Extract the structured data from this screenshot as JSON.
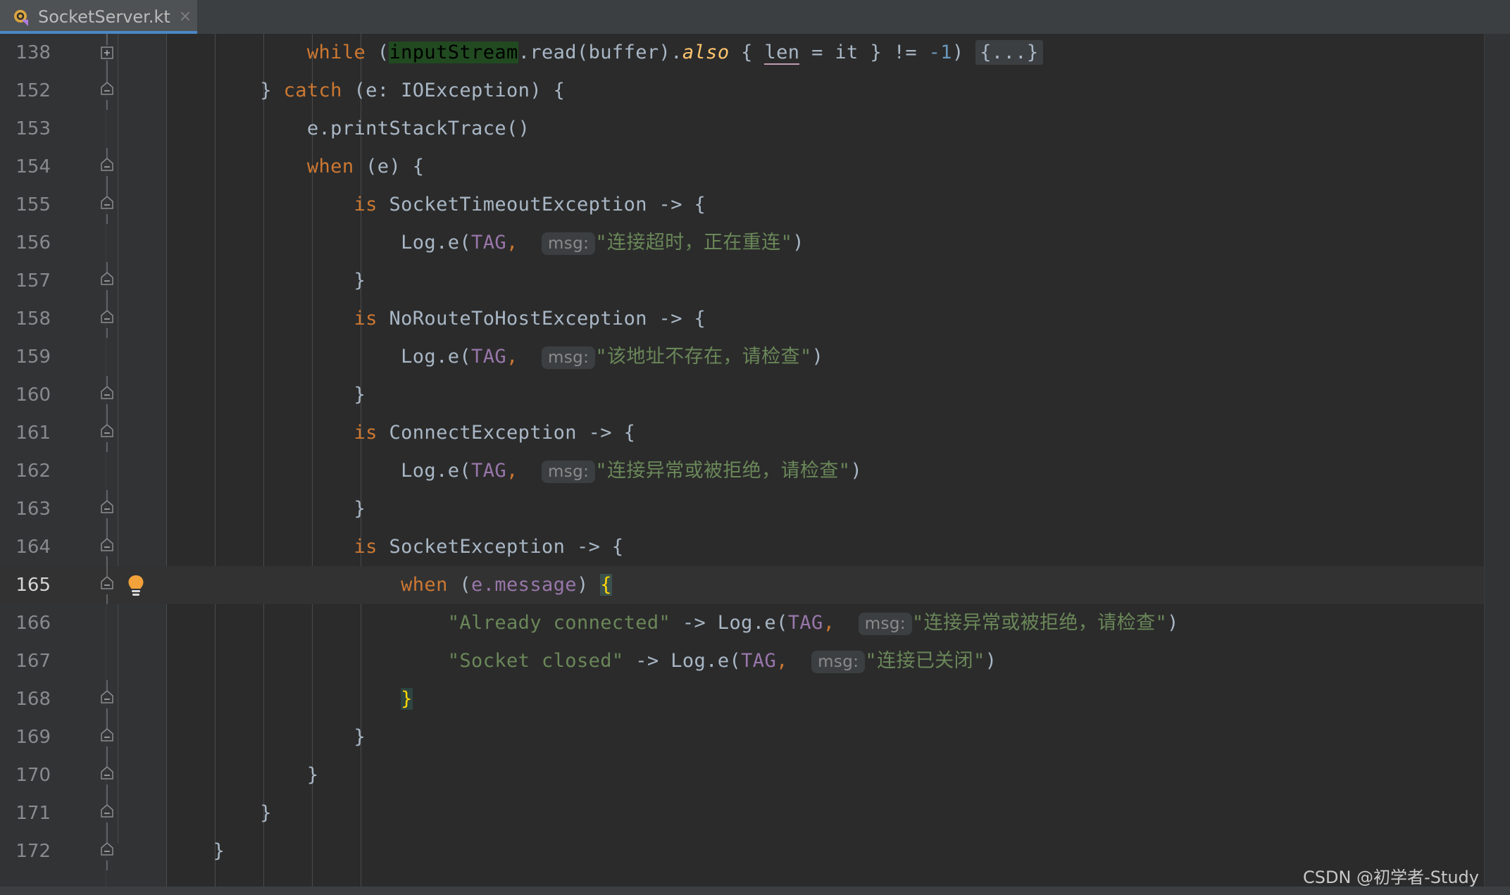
{
  "window": {
    "background_color": "#2b2b2b",
    "editor_background": "#2b2b2b",
    "gutter_background": "#313335",
    "accent_color": "#4a88c7"
  },
  "tab": {
    "label": "SocketServer.kt",
    "close_label": "×",
    "icon_name": "kotlin-file-icon"
  },
  "editor": {
    "current_line": "165",
    "lines": [
      {
        "num": "138",
        "fold": "plus"
      },
      {
        "num": "152",
        "fold": "minus"
      },
      {
        "num": "153",
        "fold": "none"
      },
      {
        "num": "154",
        "fold": "minus"
      },
      {
        "num": "155",
        "fold": "minus"
      },
      {
        "num": "156",
        "fold": "none"
      },
      {
        "num": "157",
        "fold": "minus"
      },
      {
        "num": "158",
        "fold": "minus"
      },
      {
        "num": "159",
        "fold": "none"
      },
      {
        "num": "160",
        "fold": "minus"
      },
      {
        "num": "161",
        "fold": "minus"
      },
      {
        "num": "162",
        "fold": "none"
      },
      {
        "num": "163",
        "fold": "minus"
      },
      {
        "num": "164",
        "fold": "minus"
      },
      {
        "num": "165",
        "fold": "minus",
        "bulb": true
      },
      {
        "num": "166",
        "fold": "none"
      },
      {
        "num": "167",
        "fold": "none"
      },
      {
        "num": "168",
        "fold": "minus"
      },
      {
        "num": "169",
        "fold": "minus"
      },
      {
        "num": "170",
        "fold": "minus"
      },
      {
        "num": "171",
        "fold": "minus"
      },
      {
        "num": "172",
        "fold": "minus"
      }
    ],
    "code_text": [
      "            while (inputStream.read(buffer).also { len = it } != -1) {...}",
      "        } catch (e: IOException) {",
      "            e.printStackTrace()",
      "            when (e) {",
      "                is SocketTimeoutException -> {",
      "                    Log.e(TAG,  msg: \"连接超时，正在重连\")",
      "                }",
      "                is NoRouteToHostException -> {",
      "                    Log.e(TAG,  msg: \"该地址不存在，请检查\")",
      "                }",
      "                is ConnectException -> {",
      "                    Log.e(TAG,  msg: \"连接异常或被拒绝，请检查\")",
      "                }",
      "                is SocketException -> {",
      "                    when (e.message) {",
      "                        \"Already connected\" -> Log.e(TAG,  msg: \"连接异常或被拒绝，请检查\")",
      "                        \"Socket closed\" -> Log.e(TAG,  msg: \"连接已关闭\")",
      "                    }",
      "                }",
      "            }",
      "        }",
      "    }"
    ],
    "inlay_hint_label": "msg:",
    "folded_placeholder": "{...}",
    "strings": {
      "timeout": "连接超时，正在重连",
      "no_route": "该地址不存在，请检查",
      "connect_refused": "连接异常或被拒绝，请检查",
      "already_connected": "Already connected",
      "socket_closed_literal": "Socket closed",
      "socket_closed_msg": "连接已关闭"
    },
    "selection_token": "inputStream",
    "syntax_colors": {
      "keyword": "#cc7832",
      "plain": "#a9b7c6",
      "string": "#6a8759",
      "number": "#6897bb",
      "field": "#9876aa",
      "italic_fn": "#ffc66d",
      "line_number": "#888b8d",
      "selection": "#214a21",
      "brace_match": "#3b514d"
    }
  },
  "watermark": {
    "text": "CSDN @初学者-Study"
  }
}
